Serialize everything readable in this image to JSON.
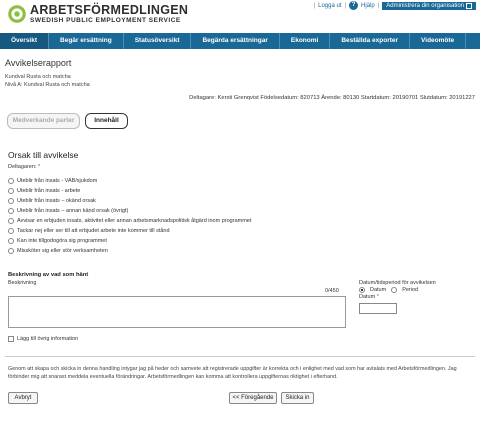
{
  "header": {
    "logo_title": "ARBETSFÖRMEDLINGEN",
    "logo_subtitle": "SWEDISH PUBLIC EMPLOYMENT SERVICE",
    "logout": "Logga ut",
    "help": "Hjälp",
    "admin": "Administrera din organisation"
  },
  "nav": {
    "items": [
      "Översikt",
      "Begär ersättning",
      "Statusöversikt",
      "Begärda ersättningar",
      "Ekonomi",
      "Beställda exporter",
      "Videomöte"
    ]
  },
  "page": {
    "title": "Avvikelserapport",
    "org_line1": "Kundval Rusta och matcha",
    "org_line2": "Nivå A: Kundval Rusta och matcha",
    "meta": "Deltagare: Kersti Grenqvist Födelsedatum: 820713 Ärende: 80130 Startdatum: 20190701 Slutdatum: 20191227"
  },
  "tabs": {
    "medverkande": "Medverkande parter",
    "innehall": "Innehåll"
  },
  "reason": {
    "title": "Orsak till avvikelse",
    "label": "Deltagaren:",
    "required": "*",
    "options": [
      "Uteblir från insats - VAB/sjukdom",
      "Uteblir från insats - arbete",
      "Uteblir från insats – okänd orsak",
      "Uteblir från insats – annan känd orsak (övrigt)",
      "Avvisar en erbjuden insats, aktivitet eller annan arbetsmarknadspolitisk åtgärd inom programmet",
      "Tackar nej eller ser till att erbjudet arbete inte kommer till stånd",
      "Kan inte tillgodogöra sig programmet",
      "Missköter sig eller stör verksamheten"
    ]
  },
  "description": {
    "title": "Beskrivning av vad som hänt",
    "sub": "Beskrivning",
    "counter": "0/450"
  },
  "date": {
    "title": "Datum/tidsperiod för avvikelsen",
    "option_date": "Datum",
    "option_period": "Period",
    "field_label": "Datum",
    "required": "*"
  },
  "attach": {
    "label": "Lägg till övrig information"
  },
  "disclaimer": "Genom att skapa och skicka in denna handling intygar jag på heder och samvete att registrerade uppgifter är korrekta och i enlighet med vad som har avtalats med Arbetsförmedlingen. Jag förbinder mig att snarast meddela eventuella förändringar. Arbetsförmedlingen kan komma att kontrollera uppgifternas riktighet i efterhand.",
  "buttons": {
    "abort": "Avbryt",
    "previous": "<< Föregående",
    "send": "Skicka in"
  }
}
